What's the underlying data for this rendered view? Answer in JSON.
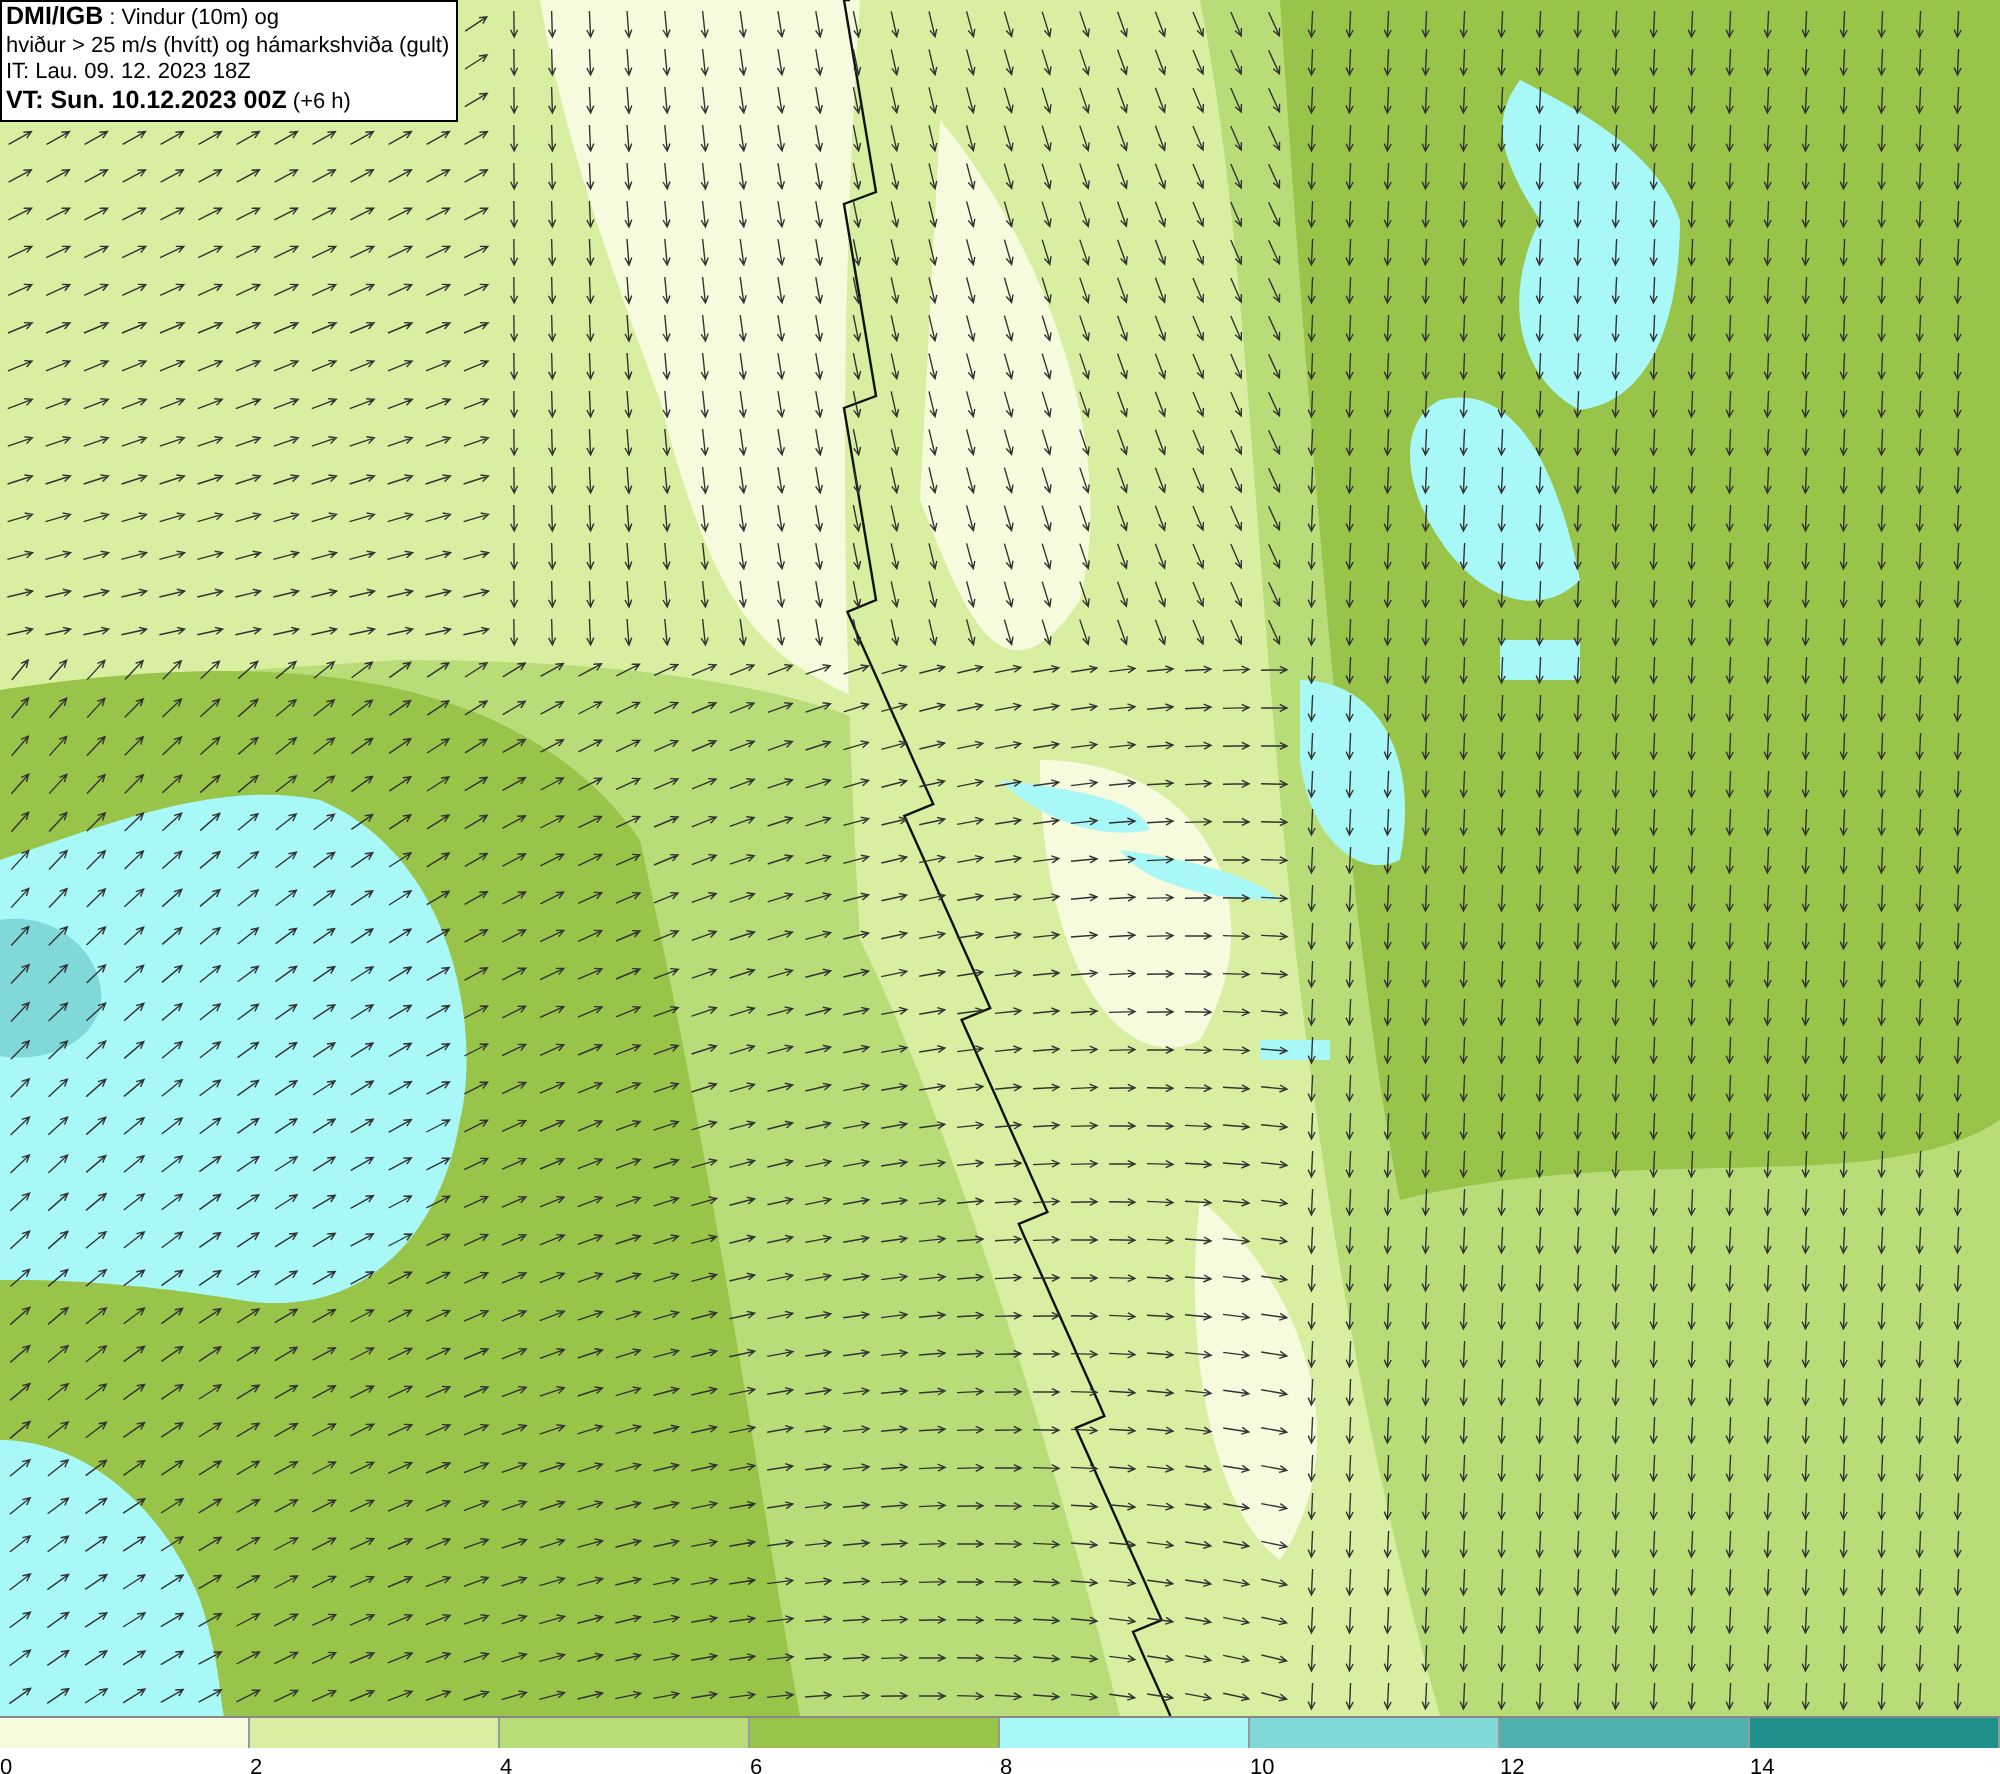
{
  "title_box": {
    "lines": [
      "**DMI/IGB** : Vindur (10m) og",
      "hviður > 25 m/s (hvítt) og hámarkshviða (gult)",
      "IT: Lau. 09. 12. 2023 18Z",
      "**VT: Sun. 10.12.2023 00Z** (+6 h)"
    ]
  },
  "legend": [
    {
      "label": "0",
      "color": "#f5fbdc"
    },
    {
      "label": "2",
      "color": "#d8eea0"
    },
    {
      "label": "4",
      "color": "#b8dc78"
    },
    {
      "label": "6",
      "color": "#98c44a"
    },
    {
      "label": "8",
      "color": "#a8f8f8"
    },
    {
      "label": "10",
      "color": "#80d8d8"
    },
    {
      "label": "12",
      "color": "#50b0b0"
    },
    {
      "label": "14",
      "color": "#20908c"
    }
  ]
}
